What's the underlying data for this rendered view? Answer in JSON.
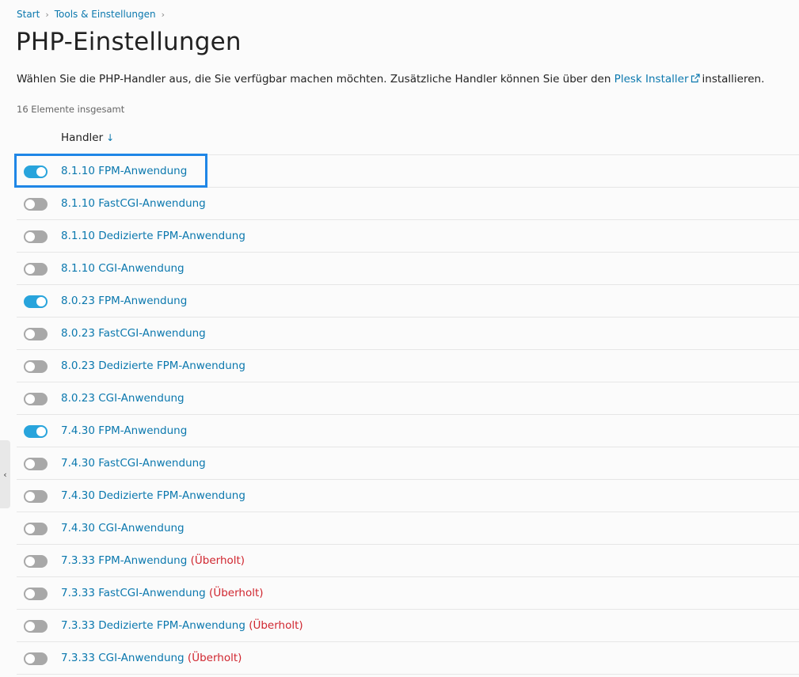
{
  "breadcrumb": {
    "items": [
      "Start",
      "Tools & Einstellungen"
    ],
    "separator": "›"
  },
  "page_title": "PHP-Einstellungen",
  "intro": {
    "text_before": "Wählen Sie die PHP-Handler aus, die Sie verfügbar machen möchten. Zusätzliche Handler können Sie über den ",
    "link": "Plesk Installer",
    "link_icon": "external-link-icon",
    "text_after": "installieren."
  },
  "total_count": "16 Elemente insgesamt",
  "table": {
    "column_header": "Handler",
    "sort_icon": "↓",
    "deprecated_label": "(Überholt)",
    "rows": [
      {
        "name": "8.1.10 FPM-Anwendung",
        "enabled": true,
        "deprecated": false
      },
      {
        "name": "8.1.10 FastCGI-Anwendung",
        "enabled": false,
        "deprecated": false
      },
      {
        "name": "8.1.10 Dedizierte FPM-Anwendung",
        "enabled": false,
        "deprecated": false
      },
      {
        "name": "8.1.10 CGI-Anwendung",
        "enabled": false,
        "deprecated": false
      },
      {
        "name": "8.0.23 FPM-Anwendung",
        "enabled": true,
        "deprecated": false
      },
      {
        "name": "8.0.23 FastCGI-Anwendung",
        "enabled": false,
        "deprecated": false
      },
      {
        "name": "8.0.23 Dedizierte FPM-Anwendung",
        "enabled": false,
        "deprecated": false
      },
      {
        "name": "8.0.23 CGI-Anwendung",
        "enabled": false,
        "deprecated": false
      },
      {
        "name": "7.4.30 FPM-Anwendung",
        "enabled": true,
        "deprecated": false
      },
      {
        "name": "7.4.30 FastCGI-Anwendung",
        "enabled": false,
        "deprecated": false
      },
      {
        "name": "7.4.30 Dedizierte FPM-Anwendung",
        "enabled": false,
        "deprecated": false
      },
      {
        "name": "7.4.30 CGI-Anwendung",
        "enabled": false,
        "deprecated": false
      },
      {
        "name": "7.3.33 FPM-Anwendung",
        "enabled": false,
        "deprecated": true
      },
      {
        "name": "7.3.33 FastCGI-Anwendung",
        "enabled": false,
        "deprecated": true
      },
      {
        "name": "7.3.33 Dedizierte FPM-Anwendung",
        "enabled": false,
        "deprecated": true
      },
      {
        "name": "7.3.33 CGI-Anwendung",
        "enabled": false,
        "deprecated": true
      }
    ]
  },
  "side_handle_icon": "chevron-left-icon",
  "colors": {
    "link": "#0b78ae",
    "toggle_on": "#28a4dc",
    "toggle_off": "#a8a8a8",
    "deprecated": "#d0262f",
    "highlight": "#1f86e6"
  }
}
